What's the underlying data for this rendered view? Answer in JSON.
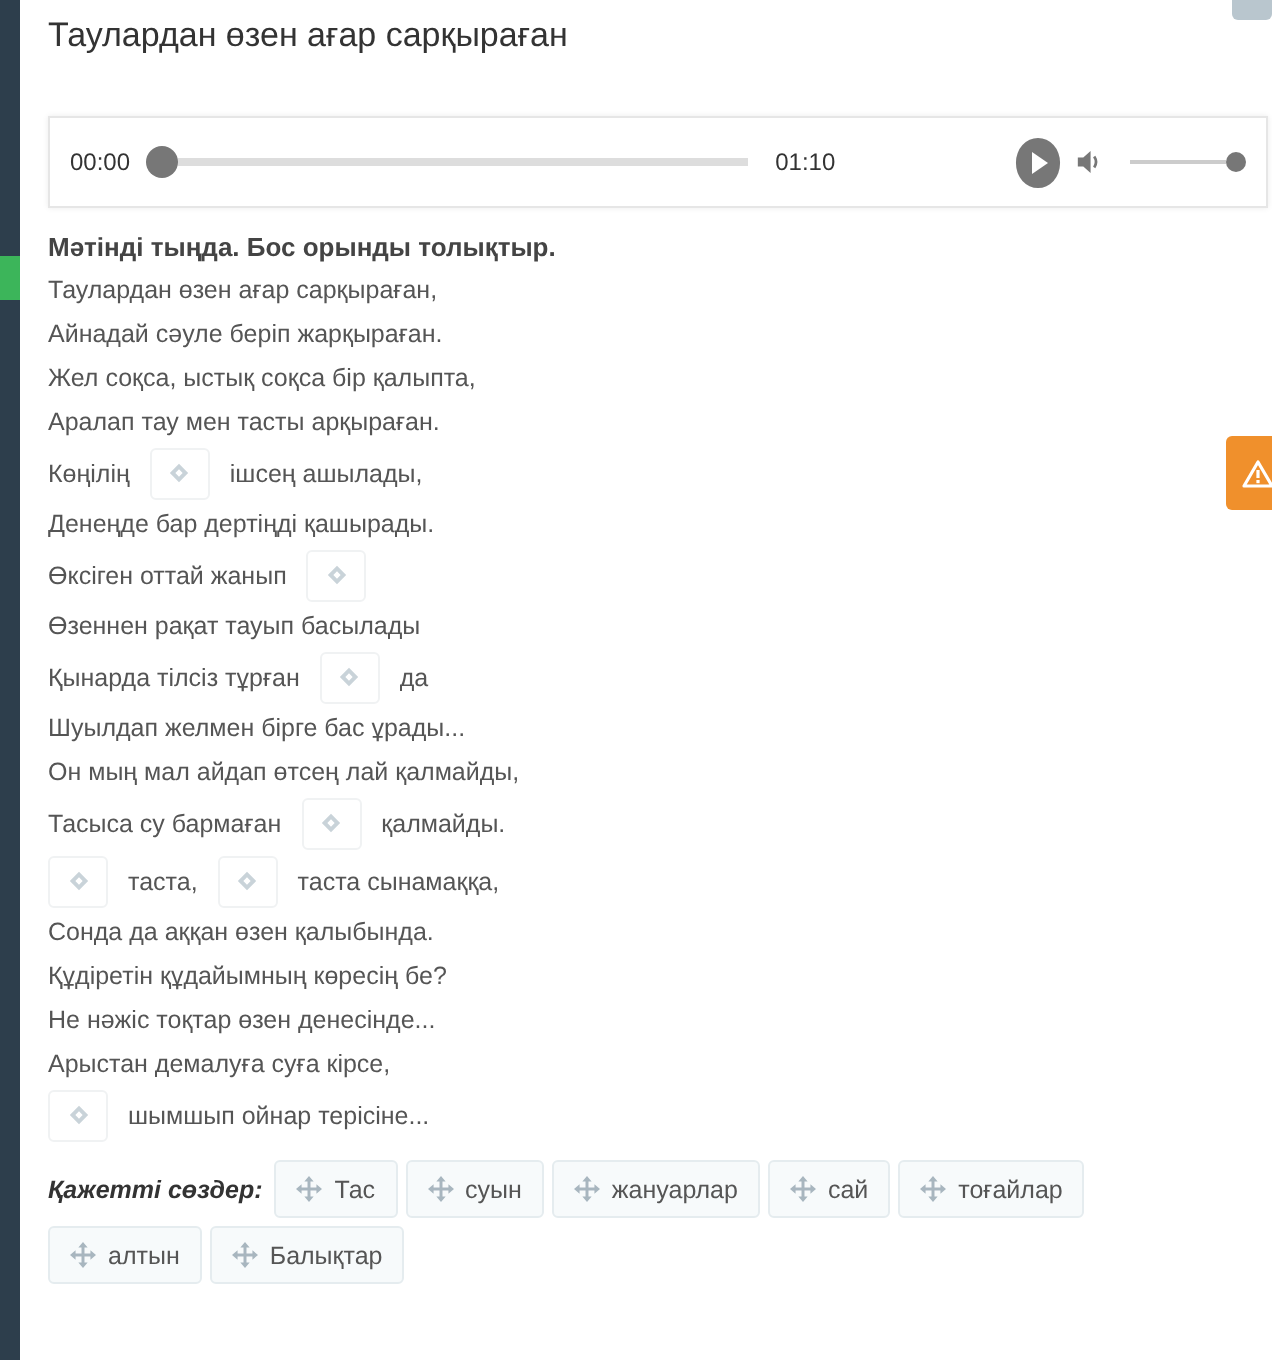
{
  "title": "Таулардан өзен ағар сарқыраған",
  "player": {
    "current_time": "00:00",
    "progress": {
      "level": 0
    },
    "duration": "01:10",
    "volume": {
      "level": 1
    }
  },
  "instruction": "Мәтінді тыңда. Бос орынды толықтыр.",
  "lines": [
    {
      "segments": [
        {
          "kind": "text",
          "text": "Таулардан өзен ағар сарқыраған,"
        }
      ]
    },
    {
      "segments": [
        {
          "kind": "text",
          "text": "Айнадай сәуле беріп жарқыраған."
        }
      ]
    },
    {
      "segments": [
        {
          "kind": "text",
          "text": "Жел соқса, ыстық соқса бір қалыпта,"
        }
      ]
    },
    {
      "segments": [
        {
          "kind": "text",
          "text": "Аралап тау мен тасты арқыраған."
        }
      ]
    },
    {
      "segments": [
        {
          "kind": "text",
          "text": "Көңілің"
        },
        {
          "kind": "gap"
        },
        {
          "kind": "text",
          "text": "ішсең ашылады,"
        }
      ]
    },
    {
      "segments": [
        {
          "kind": "text",
          "text": "Денеңде бар дертіңді қашырады."
        }
      ]
    },
    {
      "segments": [
        {
          "kind": "text",
          "text": "Өксіген оттай жанып"
        },
        {
          "kind": "gap"
        }
      ]
    },
    {
      "segments": [
        {
          "kind": "text",
          "text": "Өзеннен рақат тауып басылады"
        }
      ]
    },
    {
      "segments": [
        {
          "kind": "text",
          "text": "Қынарда тілсіз тұрған"
        },
        {
          "kind": "gap"
        },
        {
          "kind": "text",
          "text": "да"
        }
      ]
    },
    {
      "segments": [
        {
          "kind": "text",
          "text": "Шуылдап желмен бірге бас ұрады..."
        }
      ]
    },
    {
      "segments": [
        {
          "kind": "text",
          "text": "Он мың мал айдап өтсең лай қалмайды,"
        }
      ]
    },
    {
      "segments": [
        {
          "kind": "text",
          "text": "Тасыса су бармаған"
        },
        {
          "kind": "gap"
        },
        {
          "kind": "text",
          "text": "қалмайды."
        }
      ]
    },
    {
      "segments": [
        {
          "kind": "gap"
        },
        {
          "kind": "text",
          "text": "таста,"
        },
        {
          "kind": "gap"
        },
        {
          "kind": "text",
          "text": "таста сынамаққа,"
        }
      ]
    },
    {
      "segments": [
        {
          "kind": "text",
          "text": "Сонда да аққан өзен қалыбында."
        }
      ]
    },
    {
      "segments": [
        {
          "kind": "text",
          "text": "Құдіретін құдайымның көресің бе?"
        }
      ]
    },
    {
      "segments": [
        {
          "kind": "text",
          "text": "Не нәжіс тоқтар өзен денесінде..."
        }
      ]
    },
    {
      "segments": [
        {
          "kind": "text",
          "text": "Арыстан демалуға суға кірсе,"
        }
      ]
    },
    {
      "segments": [
        {
          "kind": "gap"
        },
        {
          "kind": "text",
          "text": "шымшып ойнар терісіне..."
        }
      ]
    }
  ],
  "word_bank": {
    "label": "Қажетті сөздер:",
    "words": [
      "Тас",
      "суын",
      "жануарлар",
      "сай",
      "тоғайлар",
      "алтын",
      "Балықтар"
    ]
  }
}
